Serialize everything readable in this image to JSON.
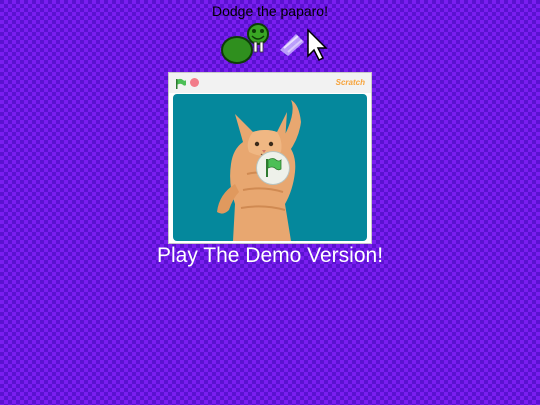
{
  "page": {
    "title": "Dodge the paparo!",
    "demo_link_label": "Play The Demo Version!"
  },
  "logo": {
    "icons": [
      "turtle-walrus-icon",
      "sparkle-trail-icon",
      "mouse-pointer-icon"
    ]
  },
  "player": {
    "controls": {
      "green_flag_icon": "green-flag-icon",
      "stop_icon": "stop-icon"
    },
    "brand_label": "Scratch",
    "stage_content": "cat-sprite",
    "overlay_button_icon": "green-flag-icon"
  },
  "colors": {
    "background_primary": "#5a12d0",
    "background_checker": "#7a1ef0",
    "stage_bg": "#05889c",
    "flag_green": "#4cbf56",
    "stop_red": "#f27c8a",
    "text_white": "#ffffff"
  }
}
